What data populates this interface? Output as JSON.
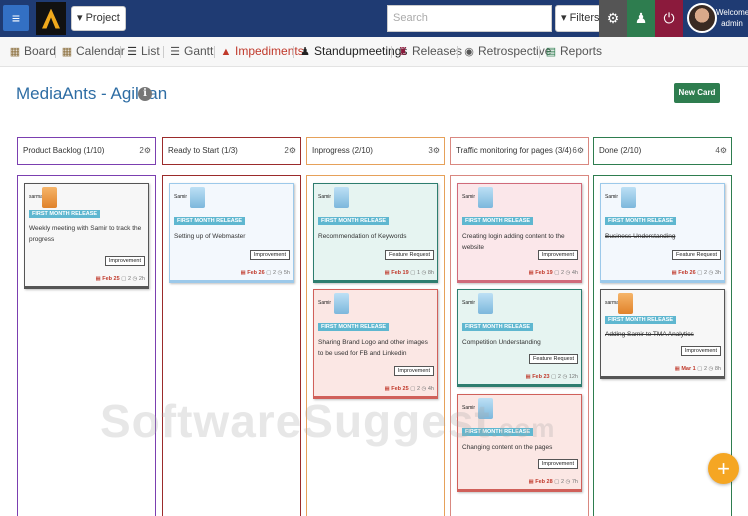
{
  "topbar": {
    "menu_icon": "hamburger-icon",
    "project_label": "▾ Project",
    "search_placeholder": "Search",
    "filters_label": "▾ Filters",
    "settings_icon": "gear-icon",
    "user_icon": "user-icon",
    "power_icon": "power-icon",
    "welcome": "Welcome",
    "username": "admin",
    "colors": {
      "bar": "#1f3b73",
      "settings": "#555555",
      "user": "#2e7d4f",
      "power": "#8b1a3c"
    }
  },
  "nav": {
    "items": [
      {
        "label": "Board",
        "icon": "grid-icon"
      },
      {
        "label": "Calendar",
        "icon": "calendar-icon"
      },
      {
        "label": "List",
        "icon": "list-icon"
      },
      {
        "label": "Gantt",
        "icon": "gantt-icon"
      },
      {
        "label": "Impediments",
        "icon": "warning-icon"
      },
      {
        "label": "Standupmeetings",
        "icon": "group-icon"
      },
      {
        "label": "Releases",
        "icon": "release-icon"
      },
      {
        "label": "Retrospective",
        "icon": "retro-icon"
      },
      {
        "label": "Reports",
        "icon": "chart-icon"
      }
    ]
  },
  "header": {
    "title": "MediaAnts - Agilean",
    "new_card_label": "New Card"
  },
  "columns": [
    {
      "title": "Product Backlog (1/10)",
      "count": "2⚙",
      "color": "#7b3fb0",
      "cards": [
        {
          "who": "sarma",
          "avatar": "orange",
          "badge": "FIRST MONTH RELEASE",
          "text": "Weekly meeting with Samir to track the progress",
          "tag": "Improvement",
          "date": "Feb 25",
          "comments": "2",
          "time": "2h",
          "bg": "#f7f7f7",
          "border": "#555555",
          "strike": false
        }
      ]
    },
    {
      "title": "Ready to Start (1/3)",
      "count": "2⚙",
      "color": "#9b2b2b",
      "cards": [
        {
          "who": "Samir",
          "avatar": "blue",
          "badge": "FIRST MONTH RELEASE",
          "text": "Setting up of Webmaster",
          "tag": "Improvement",
          "date": "Feb 26",
          "comments": "2",
          "time": "5h",
          "bg": "#f3f8fd",
          "border": "#9cc9ea",
          "strike": false
        }
      ]
    },
    {
      "title": "Inprogress (2/10)",
      "count": "3⚙",
      "color": "#e6a15a",
      "cards": [
        {
          "who": "Samir",
          "avatar": "blue",
          "badge": "FIRST MONTH RELEASE",
          "text": "Recommendation of Keywords",
          "tag": "Feature Request",
          "date": "Feb 19",
          "comments": "1",
          "time": "8h",
          "bg": "#e6f4f1",
          "border": "#2e7d6f",
          "strike": false
        },
        {
          "who": "Samir",
          "avatar": "blue",
          "badge": "FIRST MONTH RELEASE",
          "text": "Sharing Brand Logo and other images to be used for FB and Linkedin",
          "tag": "Improvement",
          "date": "Feb 25",
          "comments": "2",
          "time": "4h",
          "bg": "#fbe7e4",
          "border": "#d0605a",
          "strike": false
        }
      ]
    },
    {
      "title": "Traffic monitoring for pages (3/4)",
      "count": "6⚙",
      "color": "#d98880",
      "cards": [
        {
          "who": "Samir",
          "avatar": "blue",
          "badge": "FIRST MONTH RELEASE",
          "text": "Creating login adding content to the website",
          "tag": "Improvement",
          "date": "Feb 19",
          "comments": "2",
          "time": "4h",
          "bg": "#fbe7ea",
          "border": "#d06a7a",
          "strike": false
        },
        {
          "who": "Samir",
          "avatar": "blue",
          "badge": "FIRST MONTH RELEASE",
          "text": "Competition Understanding",
          "tag": "Feature Request",
          "date": "Feb 23",
          "comments": "2",
          "time": "12h",
          "bg": "#e6f4f1",
          "border": "#2e7d6f",
          "strike": false
        },
        {
          "who": "Samir",
          "avatar": "blue",
          "badge": "FIRST MONTH RELEASE",
          "text": "Changing content on the pages",
          "tag": "Improvement",
          "date": "Feb 28",
          "comments": "2",
          "time": "7h",
          "bg": "#fbe7e4",
          "border": "#d0605a",
          "strike": false
        }
      ]
    },
    {
      "title": "Done (2/10)",
      "count": "4⚙",
      "color": "#2e7d4f",
      "cards": [
        {
          "who": "Samir",
          "avatar": "blue",
          "badge": "FIRST MONTH RELEASE",
          "text": "Business Understanding",
          "tag": "Feature Request",
          "date": "Feb 26",
          "comments": "2",
          "time": "3h",
          "bg": "#f3f8fd",
          "border": "#9cc9ea",
          "strike": true
        },
        {
          "who": "sarma",
          "avatar": "orange",
          "badge": "FIRST MONTH RELEASE",
          "text": "Adding Samir to TMA Analytics",
          "tag": "Improvement",
          "date": "Mar 1",
          "comments": "2",
          "time": "8h",
          "bg": "#f7f7f7",
          "border": "#555555",
          "strike": true
        }
      ]
    }
  ],
  "fab_icon": "plus-icon",
  "watermark": {
    "main": "SoftwareSuggest",
    "suffix": ".com"
  }
}
